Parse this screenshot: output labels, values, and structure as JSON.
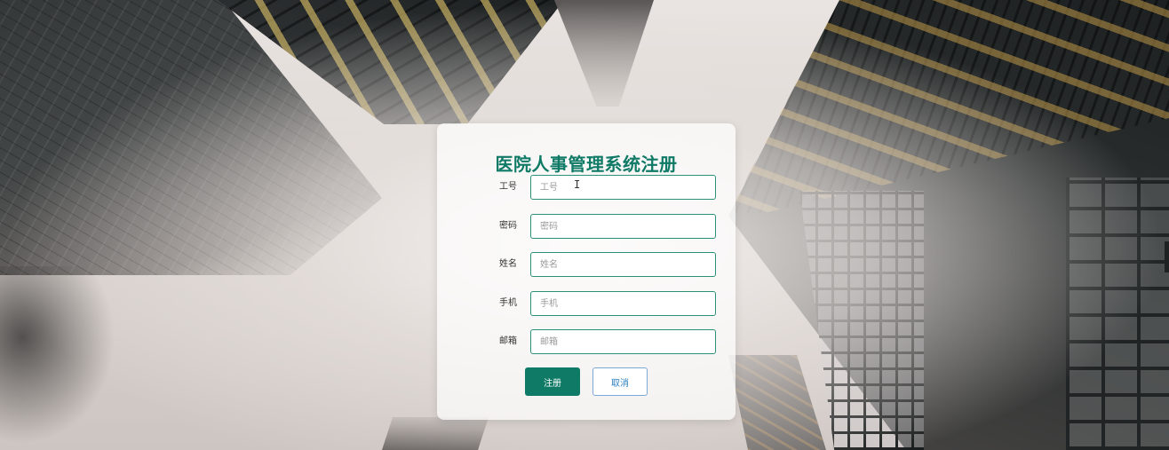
{
  "form": {
    "title": "医院人事管理系统注册",
    "fields": [
      {
        "label": "工号",
        "placeholder": "工号",
        "value": ""
      },
      {
        "label": "密码",
        "placeholder": "密码",
        "value": ""
      },
      {
        "label": "姓名",
        "placeholder": "姓名",
        "value": ""
      },
      {
        "label": "手机",
        "placeholder": "手机",
        "value": ""
      },
      {
        "label": "邮箱",
        "placeholder": "邮箱",
        "value": ""
      }
    ],
    "register_label": "注册",
    "cancel_label": "取消"
  },
  "colors": {
    "accent": "#0f7a66",
    "input_border": "#2a9178",
    "cancel_text": "#2a7fc1"
  }
}
